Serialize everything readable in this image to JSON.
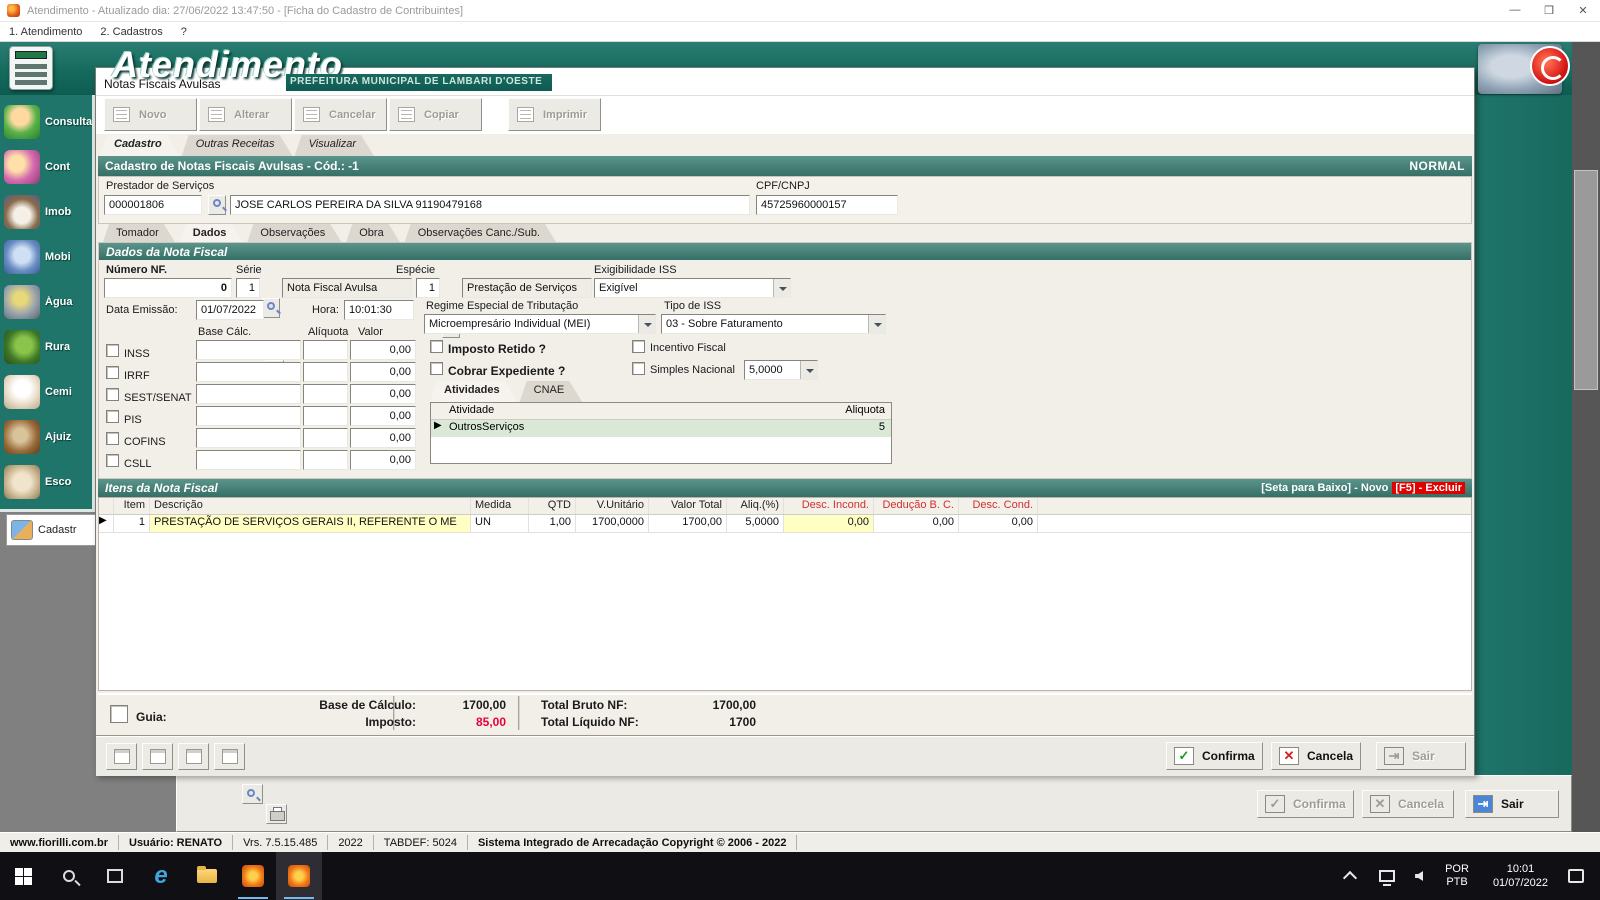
{
  "window": {
    "title": "Atendimento - Atualizado dia: 27/06/2022 13:47:50 - [Ficha do Cadastro de Contribuintes]",
    "minimize": "—",
    "maximize": "❒",
    "close": "✕"
  },
  "menu": {
    "items": [
      "1. Atendimento",
      "2. Cadastros",
      "?"
    ]
  },
  "banner": {
    "app": "Atendimento",
    "org": "PREFEITURA MUNICIPAL DE LAMBARI D'OESTE"
  },
  "sidebar": {
    "items": [
      {
        "label": "Consulta",
        "icon": "consult-person-icon"
      },
      {
        "label": "Cont",
        "icon": "taxpayers-people-icon"
      },
      {
        "label": "Imob",
        "icon": "house-icon"
      },
      {
        "label": "Mobi",
        "icon": "building-icon"
      },
      {
        "label": "Água",
        "icon": "water-faucet-icon"
      },
      {
        "label": "Rura",
        "icon": "tractor-icon"
      },
      {
        "label": "Cemi",
        "icon": "angel-icon"
      },
      {
        "label": "Ajuiz",
        "icon": "gavel-icon"
      },
      {
        "label": "Esco",
        "icon": "school-icon"
      }
    ],
    "cadastr": "Cadastr"
  },
  "dialog": {
    "title": "Notas Fiscais Avulsas",
    "toolbar": [
      {
        "label": "Novo"
      },
      {
        "label": "Alterar"
      },
      {
        "label": "Cancelar"
      },
      {
        "label": "Copiar"
      },
      {
        "label": "Imprimir"
      }
    ],
    "tabs": [
      {
        "label": "Cadastro"
      },
      {
        "label": "Outras Receitas"
      },
      {
        "label": "Visualizar"
      }
    ],
    "header": {
      "title": "Cadastro de Notas Fiscais Avulsas - Cód.: -1",
      "status": "NORMAL"
    },
    "prestador": {
      "label": "Prestador de Serviços",
      "code": "000001806",
      "name": "JOSE CARLOS PEREIRA DA SILVA 91190479168",
      "cpf_label": "CPF/CNPJ",
      "cpf": "45725960000157"
    },
    "inner_tabs": [
      {
        "label": "Tomador"
      },
      {
        "label": "Dados"
      },
      {
        "label": "Observações"
      },
      {
        "label": "Obra"
      },
      {
        "label": "Observações Canc./Sub."
      }
    ],
    "dados": {
      "title": "Dados da Nota Fiscal",
      "numero_label": "Número NF.",
      "numero": "0",
      "serie_label": "Série",
      "serie_code": "1",
      "serie_desc": "Nota Fiscal Avulsa",
      "especie_label": "Espécie",
      "especie_code": "1",
      "especie_desc": "Prestação de Serviços",
      "exig_label": "Exigibilidade ISS",
      "exig": "Exigível",
      "data_label": "Data Emissão:",
      "data": "01/07/2022",
      "hora_label": "Hora:",
      "hora": "10:01:30",
      "regime_label": "Regime Especial de Tributação",
      "regime": "Microempresário Individual (MEI)",
      "tipo_label": "Tipo de ISS",
      "tipo": "03 - Sobre Faturamento",
      "grid_headers": {
        "base": "Base Cálc.",
        "aliquota": "Alíquota",
        "valor": "Valor"
      },
      "taxes": [
        {
          "label": "INSS",
          "valor": "0,00"
        },
        {
          "label": "IRRF",
          "valor": "0,00"
        },
        {
          "label": "SEST/SENAT",
          "valor": "0,00"
        },
        {
          "label": "PIS",
          "valor": "0,00"
        },
        {
          "label": "COFINS",
          "valor": "0,00"
        },
        {
          "label": "CSLL",
          "valor": "0,00"
        }
      ],
      "imposto_retido": "Imposto Retido ?",
      "cobrar_expediente": "Cobrar Expediente ?",
      "incentivo": "Incentivo Fiscal",
      "simples_label": "Simples Nacional",
      "simples": "5,0000",
      "ativ_tabs": [
        {
          "label": "Atividades"
        },
        {
          "label": "CNAE"
        }
      ],
      "ativ_headers": {
        "atividade": "Atividade",
        "aliquota": "Aliquota"
      },
      "ativ_rows": [
        {
          "atividade": "OutrosServiços",
          "aliquota": "5"
        }
      ]
    },
    "itens": {
      "title": "Itens da Nota Fiscal",
      "hint": "[Seta para Baixo] - Novo",
      "hint_red": "[F5] - Excluir",
      "headers": [
        "Item",
        "Descrição",
        "Medida",
        "QTD",
        "V.Unitário",
        "Valor Total",
        "Aliq.(%)",
        "Desc. Incond.",
        "Dedução B. C.",
        "Desc. Cond."
      ],
      "row": {
        "item": "1",
        "desc": "PRESTAÇÃO DE SERVIÇOS GERAIS II, REFERENTE O ME",
        "medida": "UN",
        "qtd": "1,00",
        "vunit": "1700,0000",
        "vtotal": "1700,00",
        "aliq": "5,0000",
        "desc_incond": "0,00",
        "deducao": "0,00",
        "desc_cond": "0,00"
      }
    },
    "footer": {
      "guia": "Guia:",
      "base_label": "Base de Cálculo:",
      "base": "1700,00",
      "imposto_label": "Imposto:",
      "imposto": "85,00",
      "bruto_label": "Total Bruto NF:",
      "bruto": "1700,00",
      "liquido_label": "Total Líquido NF:",
      "liquido": "1700"
    },
    "buttons": {
      "confirma": "Confirma",
      "cancela": "Cancela",
      "sair": "Sair"
    }
  },
  "outer": {
    "confirma": "Confirma",
    "cancela": "Cancela",
    "sair": "Sair"
  },
  "statusbar": {
    "site": "www.fiorilli.com.br",
    "user": "Usuário: RENATO",
    "version": "Vrs. 7.5.15.485",
    "year": "2022",
    "tabdef": "TABDEF: 5024",
    "copyright": "Sistema Integrado de Arrecadação Copyright © 2006 - 2022"
  },
  "taskbar": {
    "lang1": "POR",
    "lang2": "PTB",
    "time": "10:01",
    "date": "01/07/2022"
  }
}
